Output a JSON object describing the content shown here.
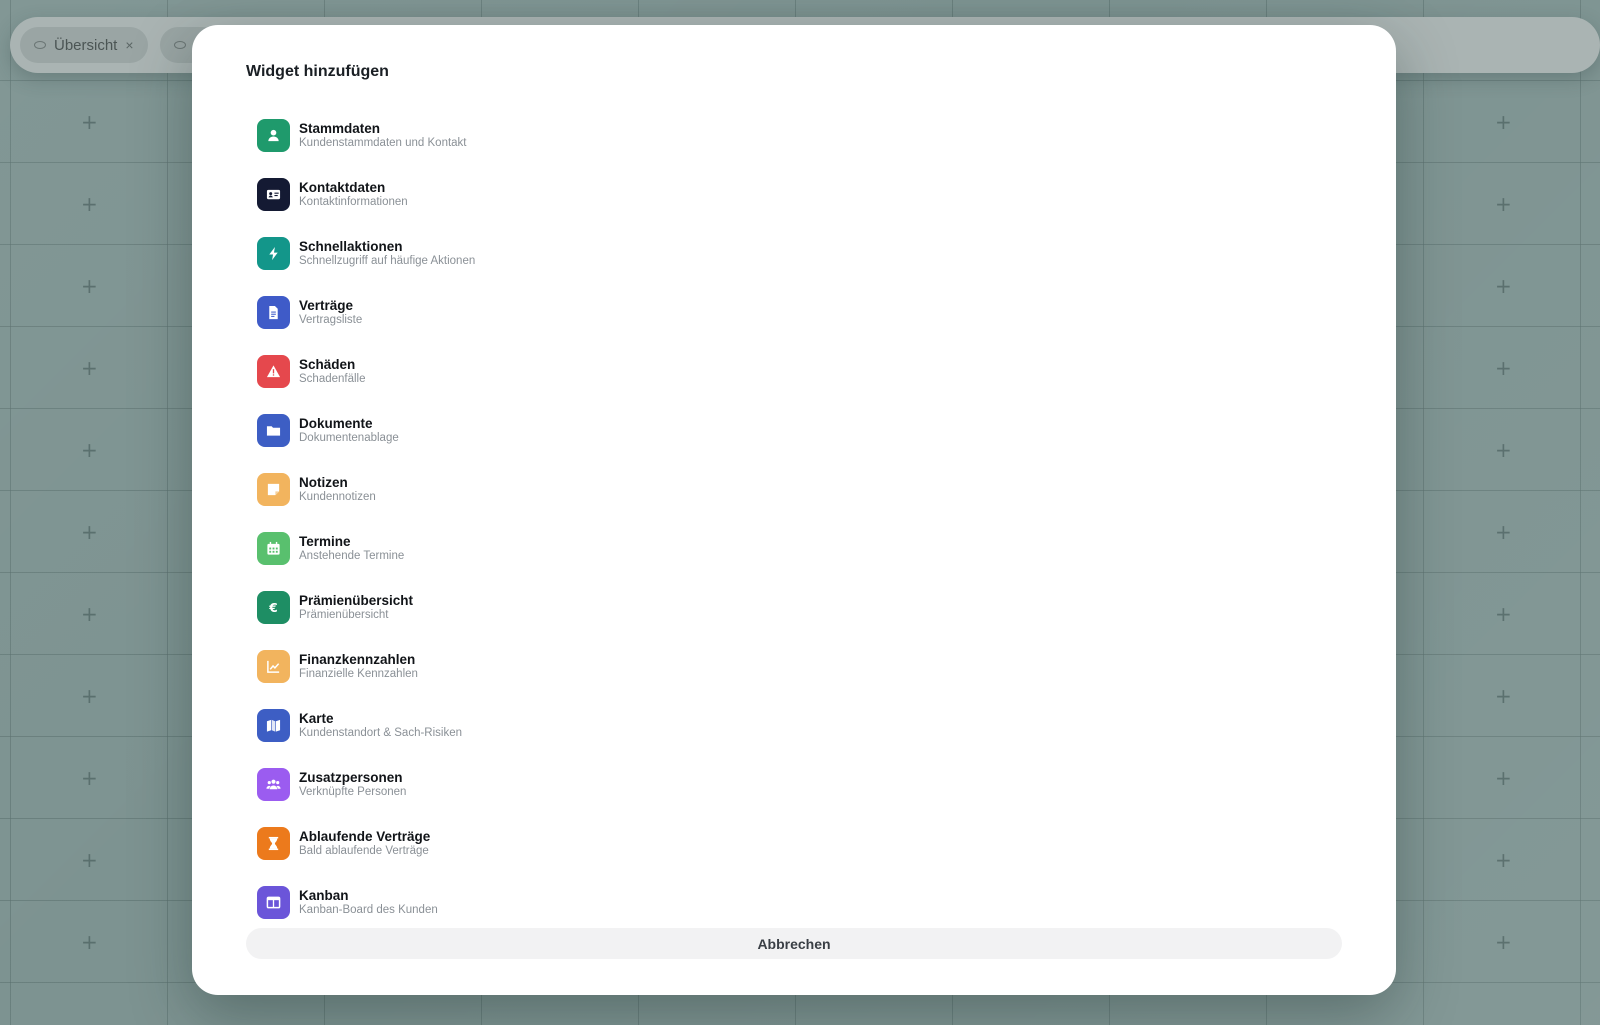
{
  "background": {
    "tabs": [
      {
        "label": "Übersicht",
        "close": "×"
      }
    ]
  },
  "modal": {
    "title": "Widget hinzufügen",
    "cancel_label": "Abbrechen",
    "widgets": [
      {
        "title": "Stammdaten",
        "subtitle": "Kundenstammdaten und Kontakt",
        "icon": "user-icon",
        "color": "#1f9a6c"
      },
      {
        "title": "Kontaktdaten",
        "subtitle": "Kontaktinformationen",
        "icon": "id-card-icon",
        "color": "#141a33"
      },
      {
        "title": "Schnellaktionen",
        "subtitle": "Schnellzugriff auf häufige Aktionen",
        "icon": "bolt-icon",
        "color": "#13968a"
      },
      {
        "title": "Verträge",
        "subtitle": "Vertragsliste",
        "icon": "file-icon",
        "color": "#3f5bc8"
      },
      {
        "title": "Schäden",
        "subtitle": "Schadenfälle",
        "icon": "warning-icon",
        "color": "#e5484d"
      },
      {
        "title": "Dokumente",
        "subtitle": "Dokumentenablage",
        "icon": "folder-icon",
        "color": "#3d5ec4"
      },
      {
        "title": "Notizen",
        "subtitle": "Kundennotizen",
        "icon": "note-icon",
        "color": "#f2b45e"
      },
      {
        "title": "Termine",
        "subtitle": "Anstehende Termine",
        "icon": "calendar-icon",
        "color": "#59c06e"
      },
      {
        "title": "Prämienübersicht",
        "subtitle": "Prämienübersicht",
        "icon": "euro-icon",
        "color": "#1e8e64"
      },
      {
        "title": "Finanzkennzahlen",
        "subtitle": "Finanzielle Kennzahlen",
        "icon": "chart-line-icon",
        "color": "#f2b45e"
      },
      {
        "title": "Karte",
        "subtitle": "Kundenstandort & Sach-Risiken",
        "icon": "map-icon",
        "color": "#3d5ec4"
      },
      {
        "title": "Zusatzpersonen",
        "subtitle": "Verknüpfte Personen",
        "icon": "users-icon",
        "color": "#9b5cf0"
      },
      {
        "title": "Ablaufende Verträge",
        "subtitle": "Bald ablaufende Verträge",
        "icon": "hourglass-icon",
        "color": "#ec7a1c"
      },
      {
        "title": "Kanban",
        "subtitle": "Kanban-Board des Kunden",
        "icon": "kanban-icon",
        "color": "#6b55d9"
      }
    ]
  }
}
